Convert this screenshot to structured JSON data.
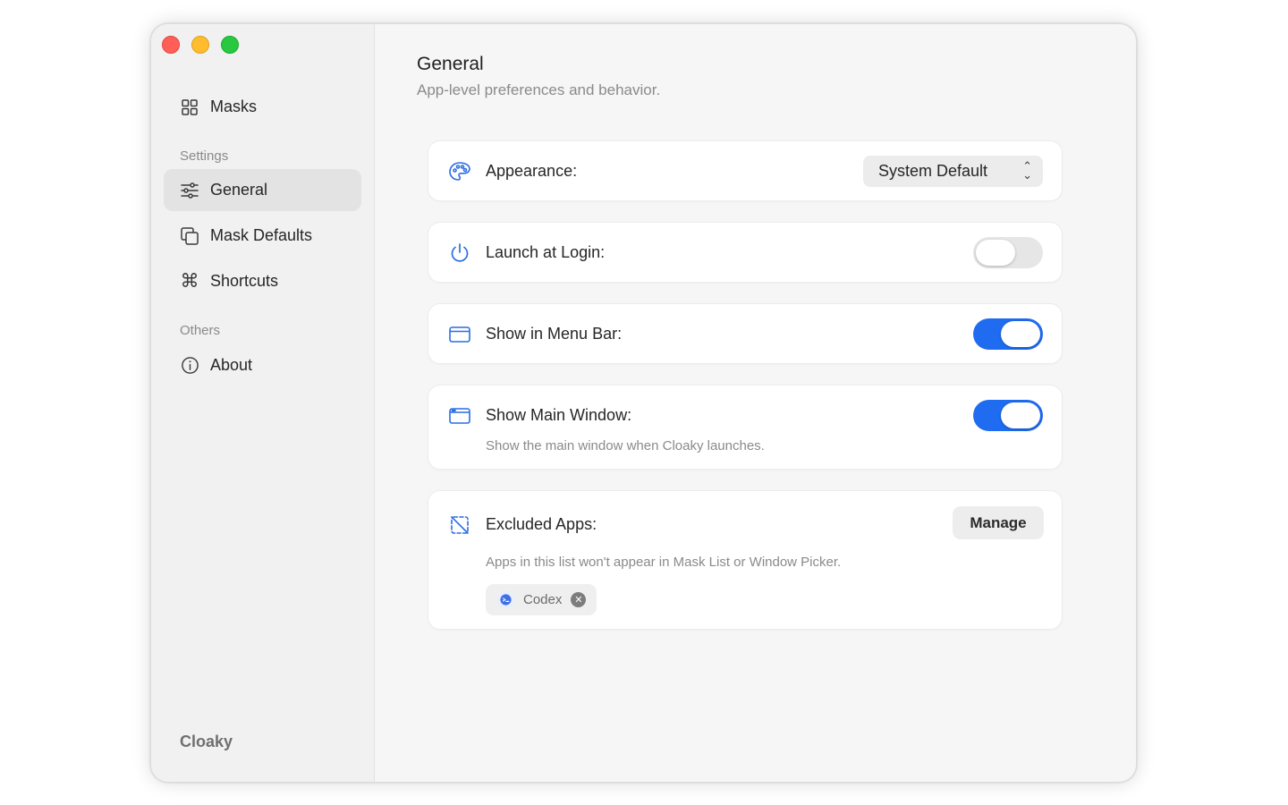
{
  "window": {
    "traffic_lights": [
      "close",
      "minimize",
      "zoom"
    ]
  },
  "sidebar": {
    "top_items": [
      {
        "label": "Masks",
        "icon": "grid-icon"
      }
    ],
    "settings_label": "Settings",
    "settings_items": [
      {
        "label": "General",
        "icon": "sliders-icon",
        "active": true
      },
      {
        "label": "Mask Defaults",
        "icon": "copy-icon",
        "active": false
      },
      {
        "label": "Shortcuts",
        "icon": "command-icon",
        "active": false
      }
    ],
    "others_label": "Others",
    "others_items": [
      {
        "label": "About",
        "icon": "info-icon"
      }
    ],
    "brand": "Cloaky"
  },
  "main": {
    "title": "General",
    "subtitle": "App-level preferences and behavior.",
    "appearance": {
      "label": "Appearance:",
      "icon": "palette-icon",
      "selected": "System Default"
    },
    "launch_at_login": {
      "label": "Launch at Login:",
      "icon": "power-icon",
      "enabled": false
    },
    "show_in_menu_bar": {
      "label": "Show in Menu Bar:",
      "icon": "menubar-icon",
      "enabled": true
    },
    "show_main_window": {
      "label": "Show Main Window:",
      "icon": "window-icon",
      "description": "Show the main window when Cloaky launches.",
      "enabled": true
    },
    "excluded_apps": {
      "label": "Excluded Apps:",
      "icon": "excluded-icon",
      "manage_label": "Manage",
      "description": "Apps in this list won't appear in Mask List or Window Picker.",
      "apps": [
        {
          "name": "Codex",
          "icon": "codex-app-icon"
        }
      ]
    }
  },
  "colors": {
    "accent": "#1f6cf0",
    "icon_blue": "#2a6de5",
    "window_bg": "#f6f6f6",
    "sidebar_bg": "#f1f1f1",
    "card_bg": "#ffffff",
    "close": "#ff5f57",
    "minimize": "#febc2e",
    "zoom": "#28c840"
  }
}
